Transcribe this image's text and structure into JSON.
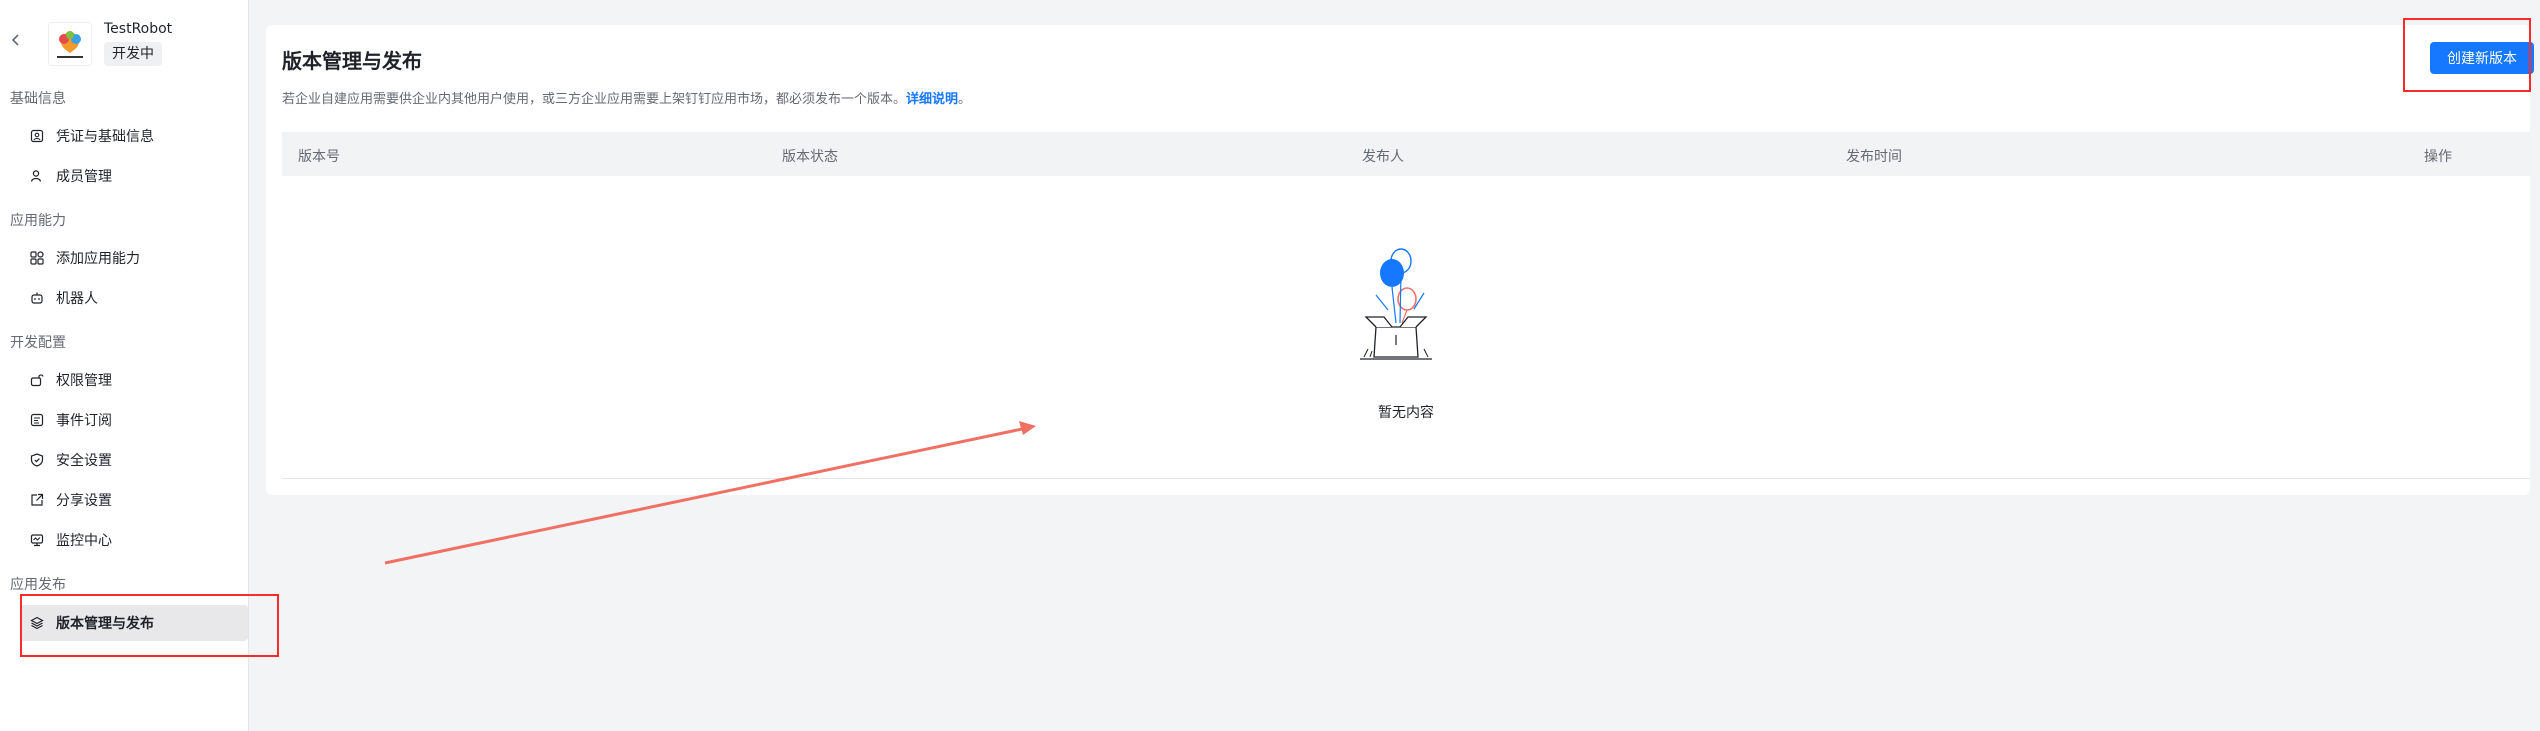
{
  "app": {
    "name": "TestRobot",
    "status": "开发中"
  },
  "sidebar": {
    "sections": [
      {
        "title": "基础信息",
        "items": [
          {
            "label": "凭证与基础信息",
            "icon": "credential-icon"
          },
          {
            "label": "成员管理",
            "icon": "member-icon"
          }
        ]
      },
      {
        "title": "应用能力",
        "items": [
          {
            "label": "添加应用能力",
            "icon": "apps-icon"
          },
          {
            "label": "机器人",
            "icon": "robot-icon"
          }
        ]
      },
      {
        "title": "开发配置",
        "items": [
          {
            "label": "权限管理",
            "icon": "permission-icon"
          },
          {
            "label": "事件订阅",
            "icon": "event-icon"
          },
          {
            "label": "安全设置",
            "icon": "shield-icon"
          },
          {
            "label": "分享设置",
            "icon": "share-icon"
          },
          {
            "label": "监控中心",
            "icon": "monitor-icon"
          }
        ]
      },
      {
        "title": "应用发布",
        "items": [
          {
            "label": "版本管理与发布",
            "icon": "layers-icon",
            "active": true
          }
        ]
      }
    ]
  },
  "main": {
    "title": "版本管理与发布",
    "description": "若企业自建应用需要供企业内其他用户使用，或三方企业应用需要上架钉钉应用市场，都必须发布一个版本。",
    "description_link": "详细说明",
    "description_tail": "。",
    "create_button": "创建新版本",
    "table": {
      "columns": [
        "版本号",
        "版本状态",
        "发布人",
        "发布时间",
        "操作"
      ],
      "rows": []
    },
    "empty_text": "暂无内容"
  },
  "colors": {
    "primary": "#1677ff",
    "annotation": "#ff2b2b",
    "arrow": "#f07064"
  }
}
